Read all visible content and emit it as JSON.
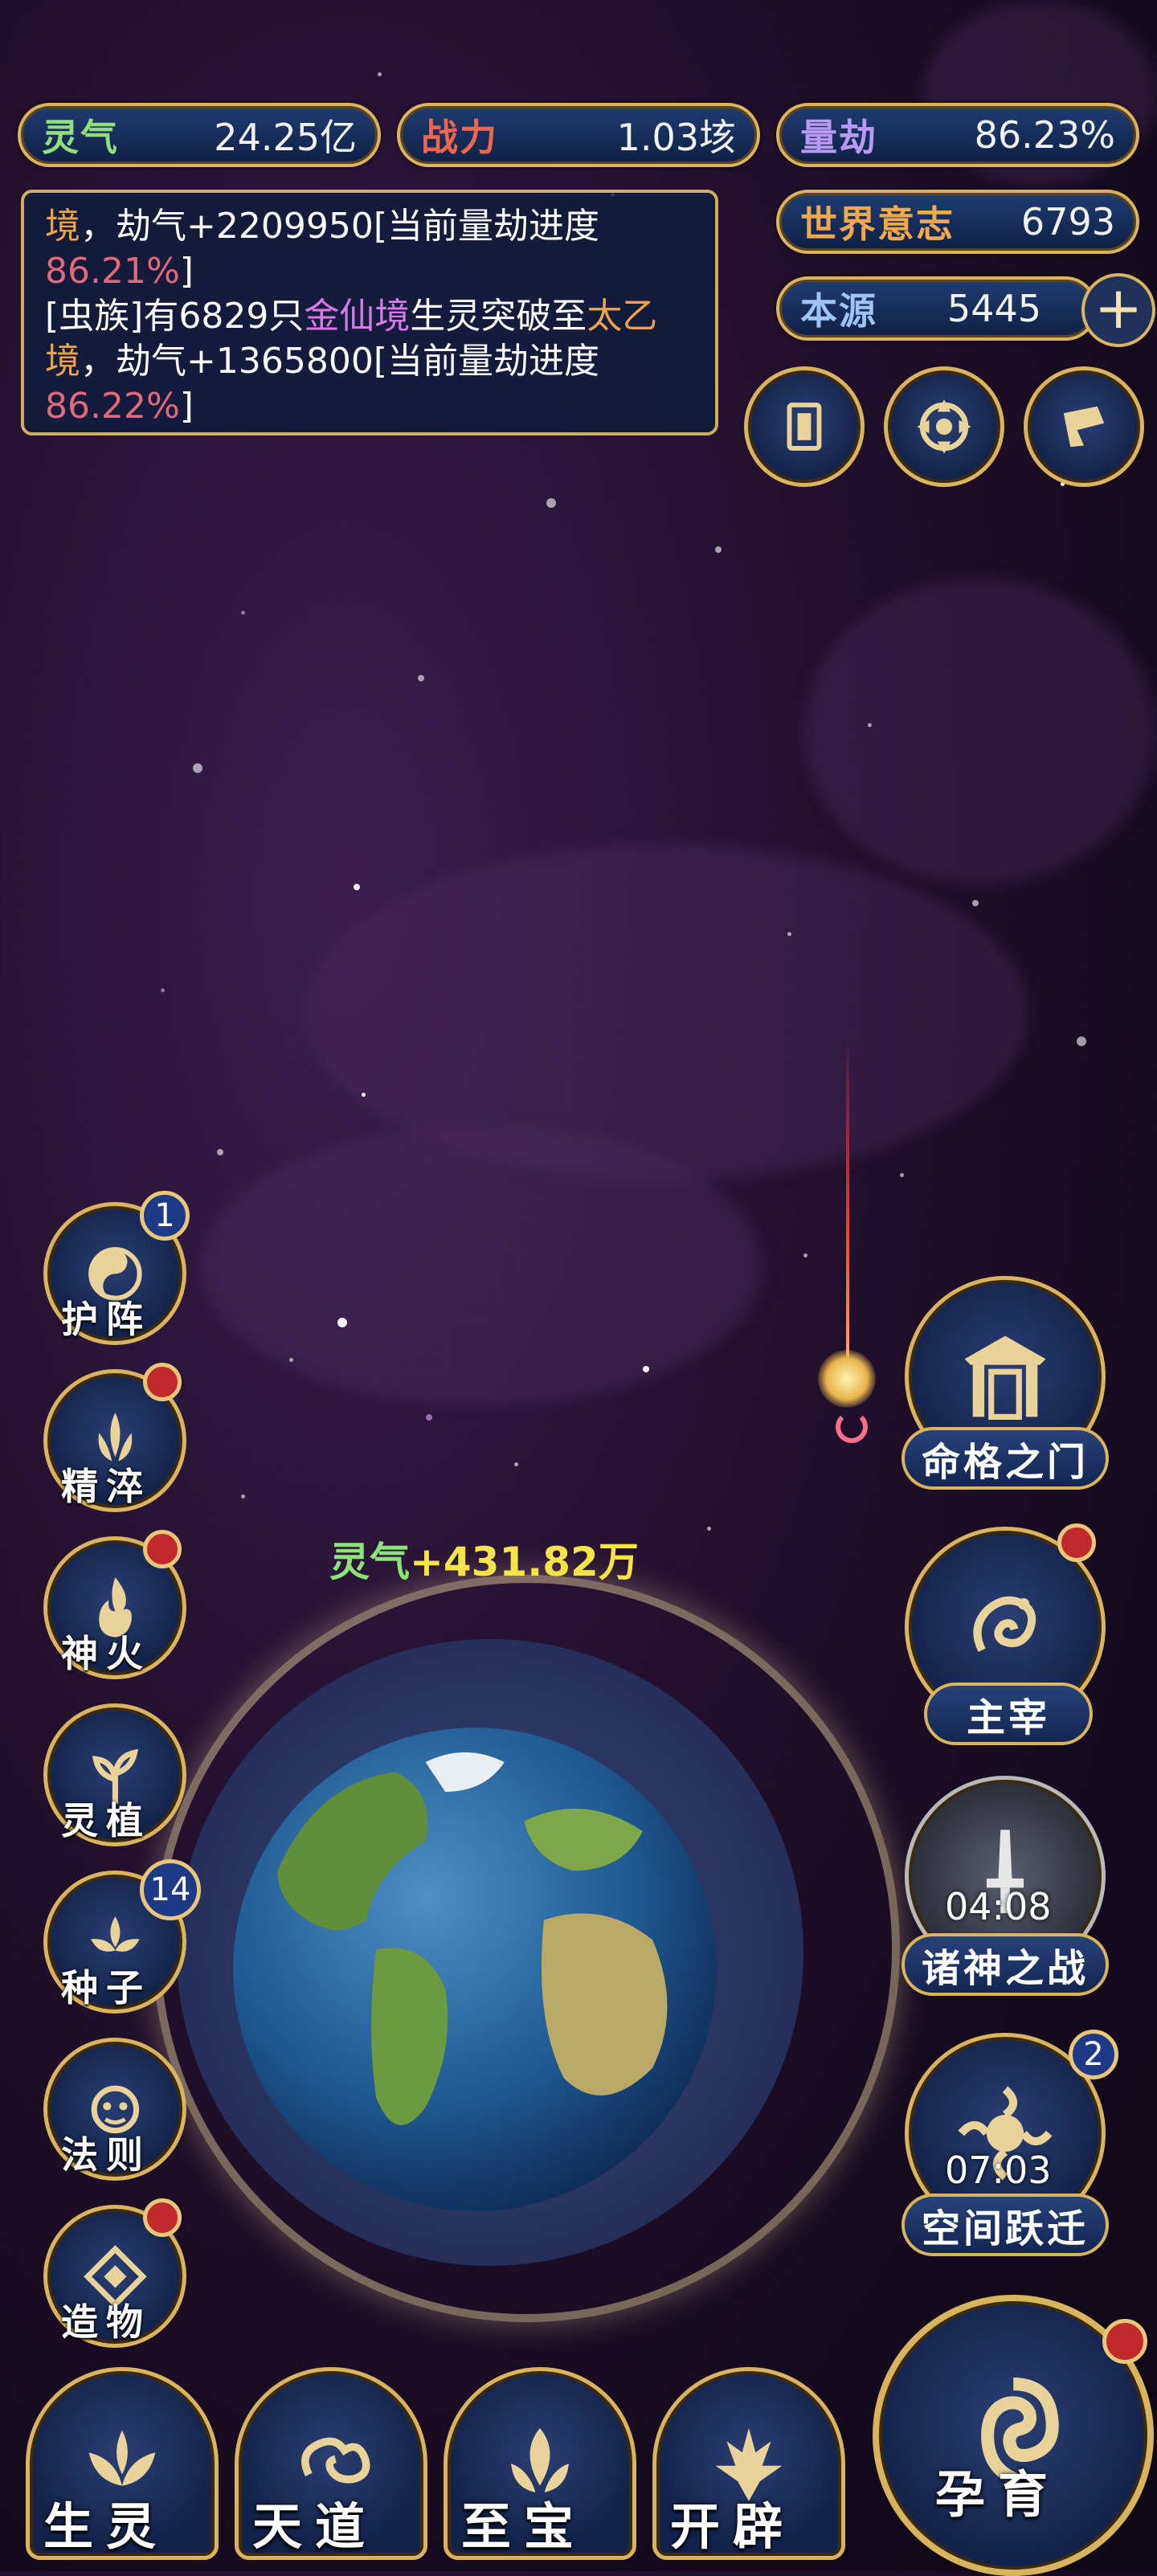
{
  "colors": {
    "gold": "#d9b45e",
    "bar_bg": "#142552",
    "accent_orange": "#e9a34a",
    "accent_pink": "#e06a7a",
    "accent_purple": "#d67ae8",
    "badge_red": "#c02a2a"
  },
  "stats": {
    "lingqi": {
      "label": "灵气",
      "value": "24.25亿"
    },
    "zhanli": {
      "label": "战力",
      "value": "1.03垓"
    },
    "liangjie": {
      "label": "量劫",
      "value": "86.23%"
    },
    "shijie": {
      "label": "世界意志",
      "value": "6793"
    },
    "benyuan": {
      "label": "本源",
      "value": "5445"
    }
  },
  "log": {
    "line1_a": "境",
    "line1_b": "，劫气+2209950[当前量劫进度",
    "line2_pct": "86.21%",
    "line2_end": "]",
    "line3_a": "[虫族]有6829只",
    "line3_gold": "金仙境",
    "line3_b": "生灵突破至",
    "line3_c": "太乙",
    "line4_a": "境",
    "line4_b": "，劫气+1365800[当前量劫进度",
    "line5_pct": "86.22%",
    "line5_end": "]"
  },
  "top_icons": [
    "card-icon",
    "portal-icon",
    "flag-icon"
  ],
  "floating_gain": {
    "label": "灵气",
    "value": "+431.82万"
  },
  "left_menu": [
    {
      "label": "护阵",
      "icon": "yin-yang-icon",
      "badge": "1"
    },
    {
      "label": "精淬",
      "icon": "lotus-flame-icon",
      "badge": "dot"
    },
    {
      "label": "神火",
      "icon": "fire-icon",
      "badge": "dot"
    },
    {
      "label": "灵植",
      "icon": "plant-icon",
      "badge": ""
    },
    {
      "label": "种子",
      "icon": "seed-icon",
      "badge": "14"
    },
    {
      "label": "法则",
      "icon": "law-icon",
      "badge": ""
    },
    {
      "label": "造物",
      "icon": "creation-icon",
      "badge": "dot"
    }
  ],
  "right_menu": [
    {
      "label": "命格之门",
      "icon": "gate-icon",
      "timer": ""
    },
    {
      "label": "主宰",
      "icon": "dragon-icon",
      "timer": "",
      "badge": "dot"
    },
    {
      "label": "诸神之战",
      "icon": "sword-icon",
      "timer": "04:08"
    },
    {
      "label": "空间跃迁",
      "icon": "sun-swirl-icon",
      "timer": "07:03",
      "badge": "2"
    }
  ],
  "bottom_nav": [
    {
      "label": "生灵",
      "icon": "phoenix-icon"
    },
    {
      "label": "天道",
      "icon": "cloud-swirl-icon"
    },
    {
      "label": "至宝",
      "icon": "treasure-icon"
    },
    {
      "label": "开辟",
      "icon": "axe-icon"
    },
    {
      "label": "孕育",
      "icon": "embryo-icon"
    }
  ]
}
